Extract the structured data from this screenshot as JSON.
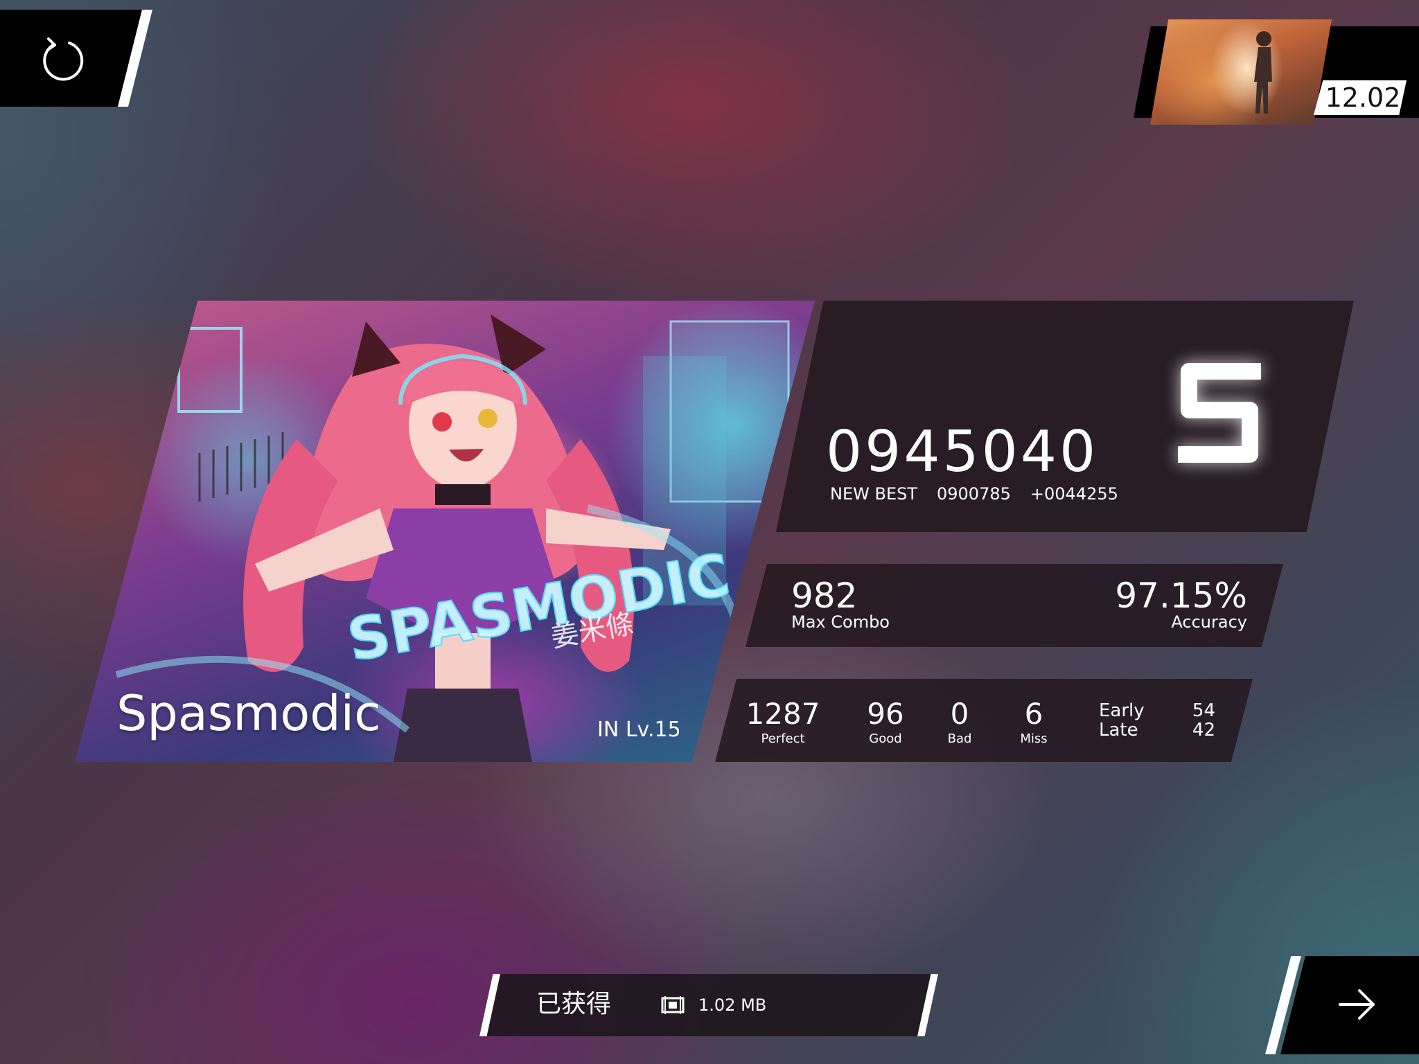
{
  "top_left": {
    "retry_icon": "retry-icon"
  },
  "player": {
    "rks": "12.02",
    "avatar": "avatar-image"
  },
  "song": {
    "title": "Spasmodic",
    "difficulty": "IN",
    "level": "Lv.15",
    "cover_logo": "SPASMODIC",
    "cover_logo_sub": "姜米條"
  },
  "result": {
    "score": "0945040",
    "new_best_label": "NEW BEST",
    "previous_best": "0900785",
    "improvement": "+0044255",
    "grade": "S",
    "max_combo": "982",
    "max_combo_label": "Max Combo",
    "accuracy": "97.15%",
    "accuracy_label": "Accuracy",
    "judgements": [
      {
        "label": "Perfect",
        "count": "1287"
      },
      {
        "label": "Good",
        "count": "96"
      },
      {
        "label": "Bad",
        "count": "0"
      },
      {
        "label": "Miss",
        "count": "6"
      }
    ],
    "early_label": "Early",
    "late_label": "Late",
    "early_count": "54",
    "late_count": "42"
  },
  "download": {
    "status": "已获得",
    "icon": "chip-icon",
    "size": "1.02 MB"
  },
  "bottom_right": {
    "next_icon": "arrow-right-icon"
  },
  "colors": {
    "panel": "#261a22",
    "accent": "#ffffff"
  }
}
